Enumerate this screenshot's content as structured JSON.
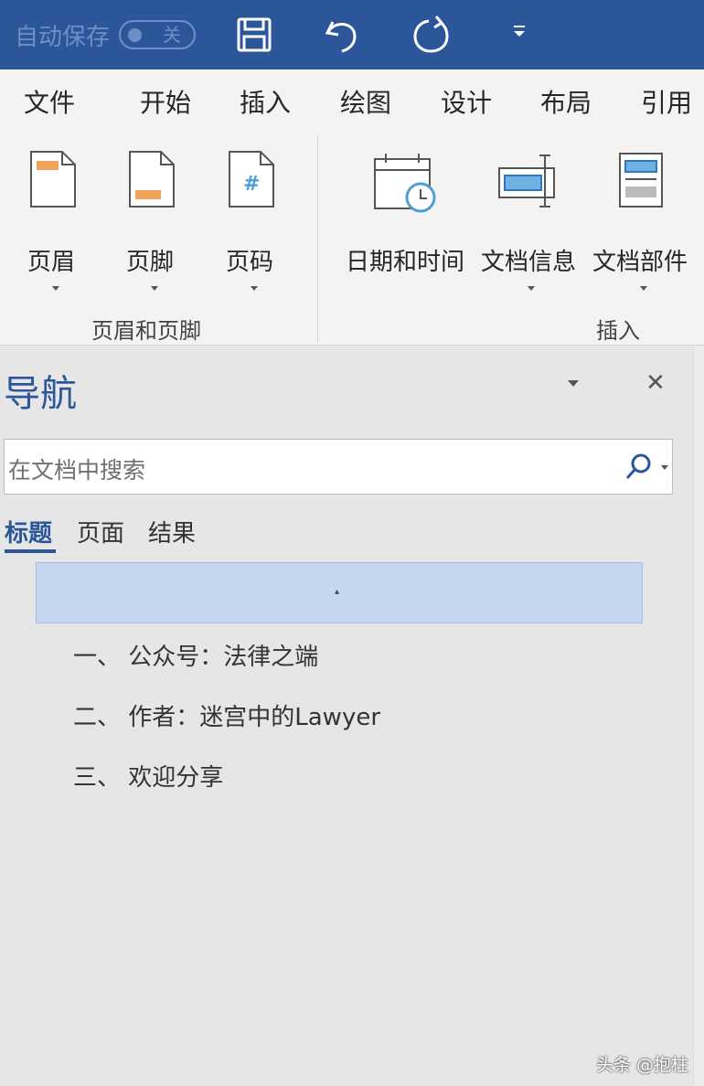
{
  "titlebar": {
    "autosave_label": "自动保存",
    "autosave_state": "关",
    "icons": [
      "save-icon",
      "undo-icon",
      "redo-icon",
      "customize-icon"
    ]
  },
  "ribbon_tabs": [
    "文件",
    "开始",
    "插入",
    "绘图",
    "设计",
    "布局",
    "引用"
  ],
  "ribbon": {
    "groups": [
      {
        "label": "页眉和页脚",
        "buttons": [
          "页眉",
          "页脚",
          "页码"
        ]
      },
      {
        "label": "插入",
        "buttons": [
          "日期和时间",
          "文档信息",
          "文档部件"
        ]
      }
    ]
  },
  "navigation": {
    "title": "导航",
    "search_placeholder": "在文档中搜索",
    "tabs": [
      "标题",
      "页面",
      "结果"
    ],
    "active_tab": "标题",
    "headings": [
      "一、 公众号：法律之端",
      "二、 作者：迷宫中的Lawyer",
      "三、 欢迎分享"
    ]
  },
  "watermark": "头条 @抱柱",
  "colors": {
    "accent": "#2b579a",
    "selection": "#c5d6ee",
    "icon_orange": "#f0a35a",
    "icon_blue": "#4d9fd6"
  }
}
